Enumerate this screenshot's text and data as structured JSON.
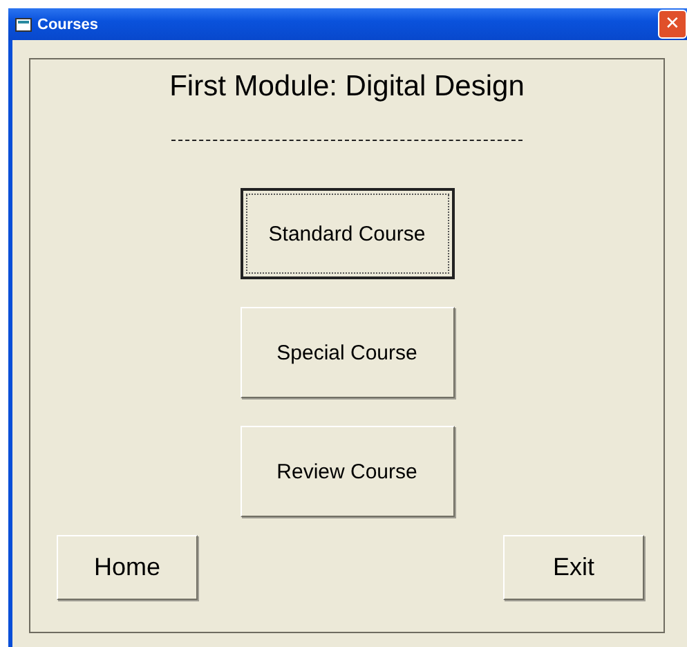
{
  "window": {
    "title": "Courses",
    "close": "✕"
  },
  "heading": "First Module: Digital Design",
  "course_buttons": [
    {
      "label": "Standard Course",
      "focused": true
    },
    {
      "label": "Special Course",
      "focused": false
    },
    {
      "label": "Review Course",
      "focused": false
    }
  ],
  "footer_buttons": [
    "Home",
    "Exit"
  ]
}
